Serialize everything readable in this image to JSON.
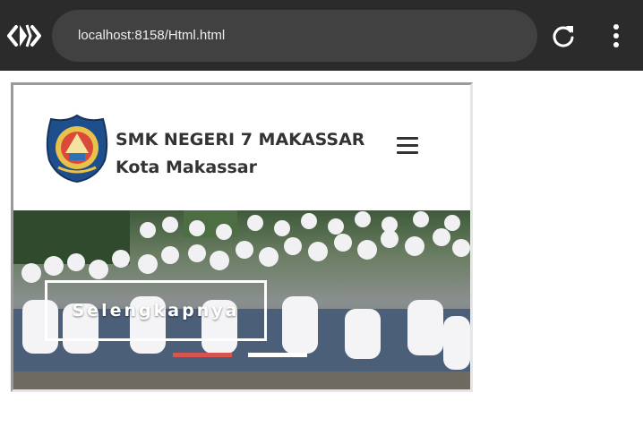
{
  "browser": {
    "url": "localhost:8158/Html.html",
    "icons": {
      "devtools": "code-brackets-icon",
      "reload": "reload-icon",
      "menu": "more-vert-icon"
    }
  },
  "site": {
    "school_name": "SMK NEGERI 7 MAKASSAR",
    "city": "Kota Makassar",
    "menu_icon": "hamburger-icon"
  },
  "hero": {
    "cta_label": "Selengkapnya",
    "active_slide": 1,
    "slide_count": 2,
    "indicator_colors": [
      "#d9534f",
      "#ffffff"
    ]
  },
  "colors": {
    "chrome_bg": "#2b2b2b",
    "urlbar_bg": "#414141",
    "accent": "#d9534f",
    "text": "#333333"
  }
}
